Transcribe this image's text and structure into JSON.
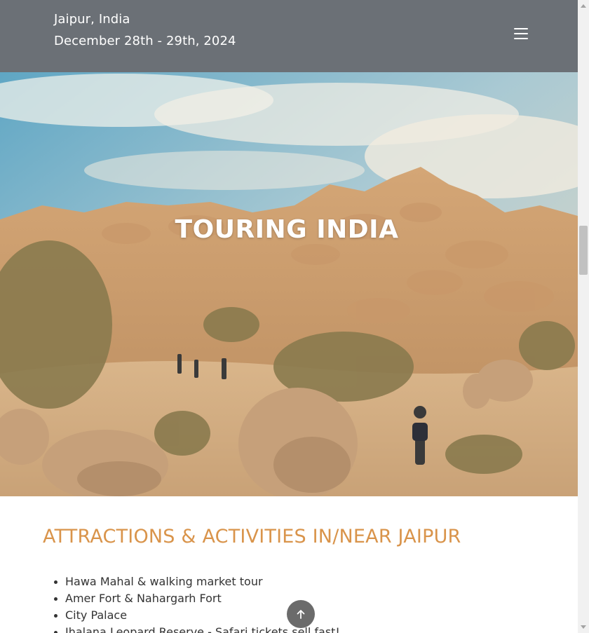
{
  "header": {
    "city": "Jaipur, India",
    "dates": "December 28th - 29th, 2024",
    "menu_icon": "hamburger-menu-icon"
  },
  "hero": {
    "title": "TOURING INDIA",
    "image": "desert-rock-landscape-with-hikers"
  },
  "attractions": {
    "title": "ATTRACTIONS & ACTIVITIES IN/NEAR JAIPUR",
    "items": [
      "Hawa Mahal & walking market tour",
      "Amer Fort & Nahargarh Fort",
      "City Palace",
      "Jhalana Leopard Reserve - Safari tickets sell fast!"
    ]
  },
  "back_to_top": {
    "icon": "arrow-up-icon"
  },
  "colors": {
    "header_bg": "#6b7076",
    "accent": "#d9944b",
    "body_text": "#333333"
  }
}
